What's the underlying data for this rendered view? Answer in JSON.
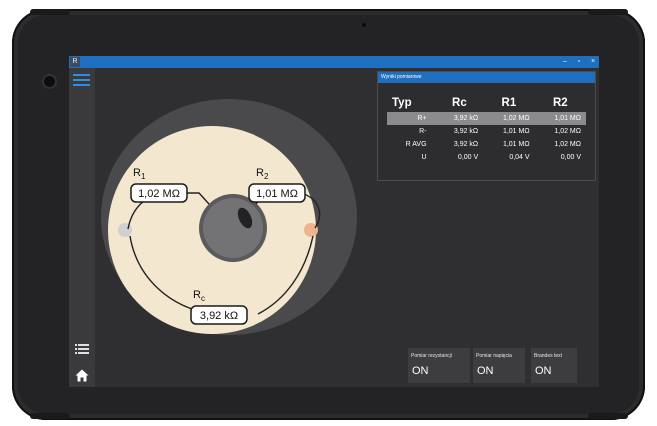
{
  "window": {
    "app_icon_letter": "R",
    "minimize_glyph": "–",
    "maximize_glyph": "▫",
    "close_glyph": "×"
  },
  "sidebar": {
    "menu_icon": "hamburger-icon",
    "list_icon": "list-icon",
    "home_icon": "home-icon"
  },
  "diagram": {
    "r1": {
      "label": "R",
      "sub": "1",
      "value": "1,02 MΩ"
    },
    "r2": {
      "label": "R",
      "sub": "2",
      "value": "1,01 MΩ"
    },
    "rc": {
      "label": "R",
      "sub": "c",
      "value": "3,92 kΩ"
    },
    "colors": {
      "outer_ring": "#4a4a4c",
      "face": "#f3e8cf",
      "core": "#737375",
      "left_terminal": "#d0cfd3",
      "right_terminal": "#efb48f"
    }
  },
  "results_panel": {
    "title": "Wyniki pomiarowe",
    "headers": [
      "Typ",
      "Rc",
      "R1",
      "R2"
    ],
    "rows": [
      [
        "R+",
        "3,92 kΩ",
        "1,02 MΩ",
        "1,01 MΩ"
      ],
      [
        "R-",
        "3,92 kΩ",
        "1,01 MΩ",
        "1,02 MΩ"
      ],
      [
        "R AVG",
        "3,92 kΩ",
        "1,01 MΩ",
        "1,02 MΩ"
      ],
      [
        "U",
        "0,00 V",
        "0,04 V",
        "0,00 V"
      ]
    ],
    "selected_row": 0
  },
  "tiles": [
    {
      "label": "Pomiar rezystancji",
      "value": "ON"
    },
    {
      "label": "Pomiar napięcia",
      "value": "ON"
    },
    {
      "label": "Brandes text",
      "value": "ON"
    }
  ],
  "colors": {
    "accent": "#1f6fc1",
    "hamburger": "#2f8de4",
    "background": "#2f2f31"
  }
}
